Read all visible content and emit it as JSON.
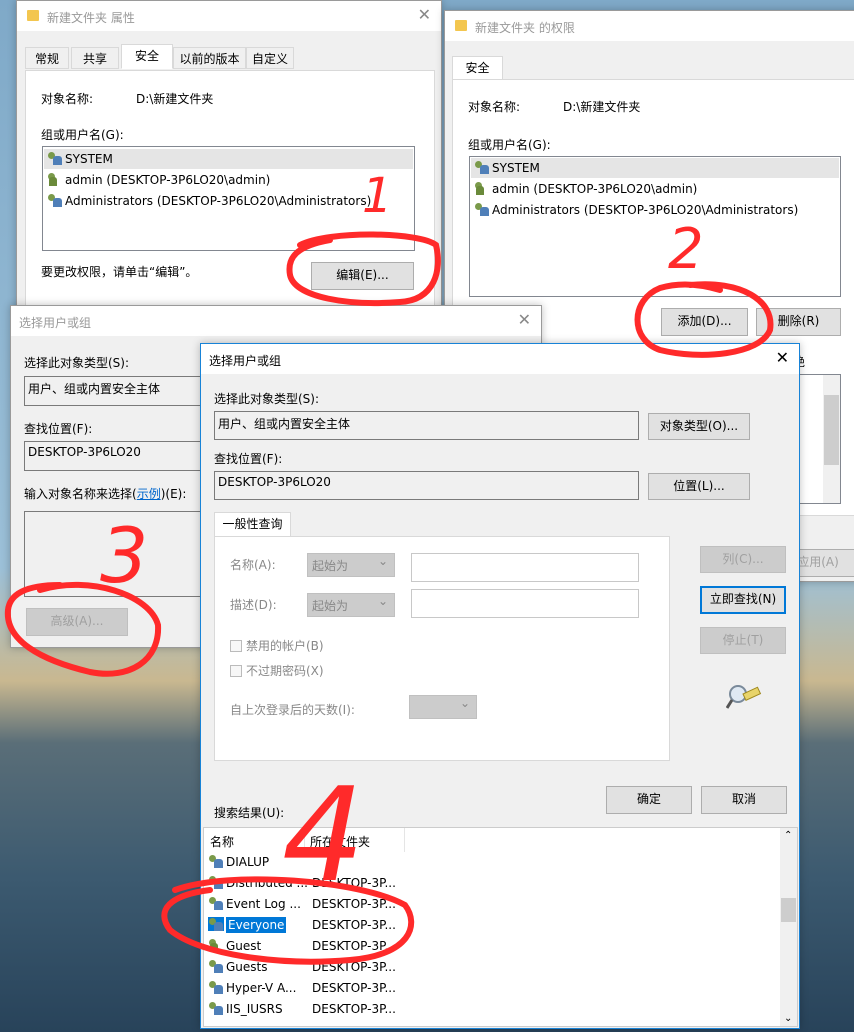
{
  "properties": {
    "title": "新建文件夹 属性",
    "tabs": [
      "常规",
      "共享",
      "安全",
      "以前的版本",
      "自定义"
    ],
    "object_label": "对象名称:",
    "object_value": "D:\\新建文件夹",
    "group_label": "组或用户名(G):",
    "users": [
      "SYSTEM",
      "admin (DESKTOP-3P6LO20\\admin)",
      "Administrators (DESKTOP-3P6LO20\\Administrators)"
    ],
    "hint": "要更改权限，请单击“编辑”。",
    "edit_btn": "编辑(E)..."
  },
  "permissions": {
    "title": "新建文件夹 的权限",
    "tab": "安全",
    "object_label": "对象名称:",
    "object_value": "D:\\新建文件夹",
    "group_label": "组或用户名(G):",
    "users": [
      "SYSTEM",
      "admin (DESKTOP-3P6LO20\\admin)",
      "Administrators (DESKTOP-3P6LO20\\Administrators)"
    ],
    "add_btn": "添加(D)...",
    "remove_btn": "删除(R)",
    "deny_partial": "拒绝",
    "apply_btn": "应用(A)"
  },
  "back_dialog": {
    "title": "选择用户或组",
    "type_label": "选择此对象类型(S):",
    "type_value": "用户、组或内置安全主体",
    "loc_label": "查找位置(F):",
    "loc_value": "DESKTOP-3P6LO20",
    "input_label": "输入对象名称来选择(",
    "input_link": "示例",
    "input_label_end": ")(E):",
    "advanced_btn": "高级(A)..."
  },
  "dialog": {
    "title": "选择用户或组",
    "type_label": "选择此对象类型(S):",
    "type_value": "用户、组或内置安全主体",
    "type_btn": "对象类型(O)...",
    "loc_label": "查找位置(F):",
    "loc_value": "DESKTOP-3P6LO20",
    "loc_btn": "位置(L)...",
    "query_tab": "一般性查询",
    "name_label": "名称(A):",
    "desc_label": "描述(D):",
    "starts_with": "起始为",
    "disabled_accounts": "禁用的帐户(B)",
    "no_expire": "不过期密码(X)",
    "days_label": "自上次登录后的天数(I):",
    "columns_btn": "列(C)...",
    "find_btn": "立即查找(N)",
    "stop_btn": "停止(T)",
    "results_label": "搜索结果(U):",
    "ok_btn": "确定",
    "cancel_btn": "取消",
    "columns": [
      "名称",
      "所在文件夹"
    ],
    "rows": [
      {
        "name": "DIALUP",
        "folder": ""
      },
      {
        "name": "Distributed ...",
        "folder": "DESKTOP-3P..."
      },
      {
        "name": "Event Log ...",
        "folder": "DESKTOP-3P..."
      },
      {
        "name": "Everyone",
        "folder": "DESKTOP-3P...",
        "selected": true
      },
      {
        "name": "Guest",
        "folder": "DESKTOP-3P..."
      },
      {
        "name": "Guests",
        "folder": "DESKTOP-3P..."
      },
      {
        "name": "Hyper-V A...",
        "folder": "DESKTOP-3P..."
      },
      {
        "name": "IIS_IUSRS",
        "folder": "DESKTOP-3P..."
      }
    ]
  },
  "annotations": {
    "color": "#ff2a2a",
    "steps": [
      "1",
      "2",
      "3",
      "4"
    ]
  },
  "colors": {
    "selection": "#0078d7",
    "accent_border": "#1883d7"
  }
}
